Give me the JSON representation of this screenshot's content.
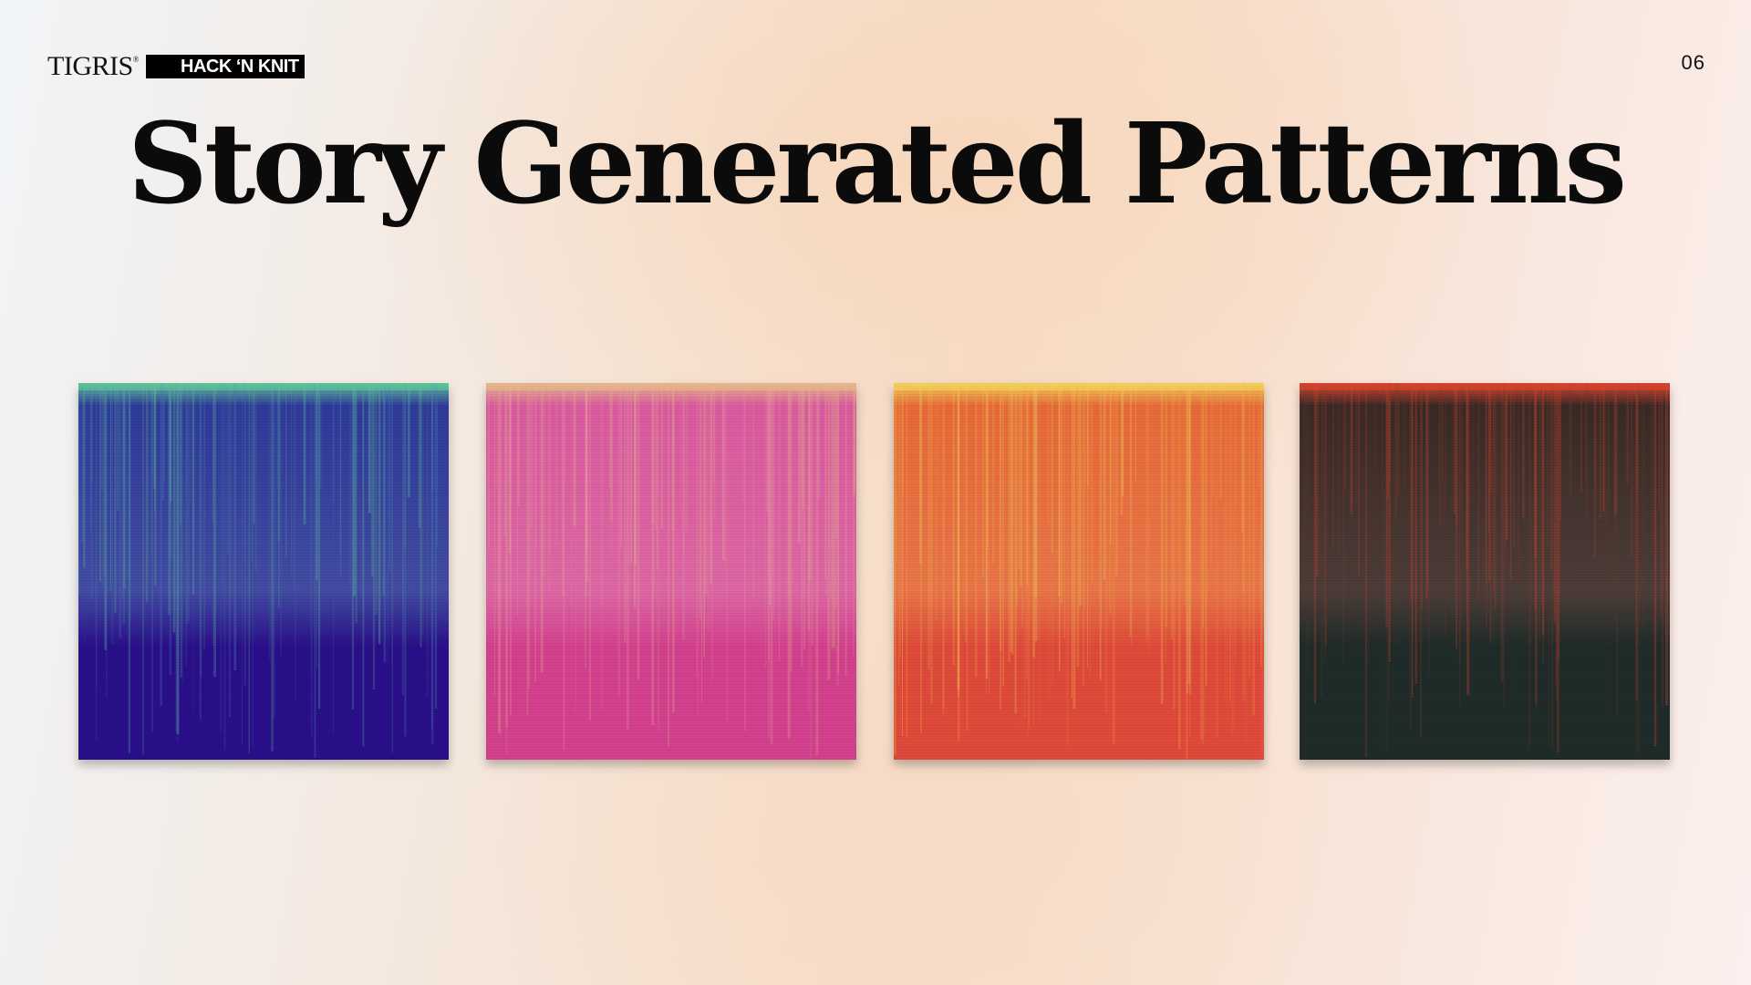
{
  "header": {
    "brand": "TIGRIS",
    "brand_mark": "®",
    "event": "HACK ‘N KNIT",
    "page_number": "06"
  },
  "title": "Story Generated Patterns",
  "patterns": [
    {
      "name": "indigo",
      "base": "#2a0f8a",
      "mid": "#2f3a9a",
      "top": "#5fc49a",
      "streak": "#4d79b8"
    },
    {
      "name": "pink",
      "base": "#d4418f",
      "mid": "#dc5aa0",
      "top": "#e6b78a",
      "streak": "#eab0a6"
    },
    {
      "name": "orange",
      "base": "#e04a3a",
      "mid": "#e86a3a",
      "top": "#f3d05a",
      "streak": "#f2a444"
    },
    {
      "name": "dark",
      "base": "#1f2c2a",
      "mid": "#3a2a26",
      "top": "#d8452e",
      "streak": "#7a3a2a"
    }
  ]
}
